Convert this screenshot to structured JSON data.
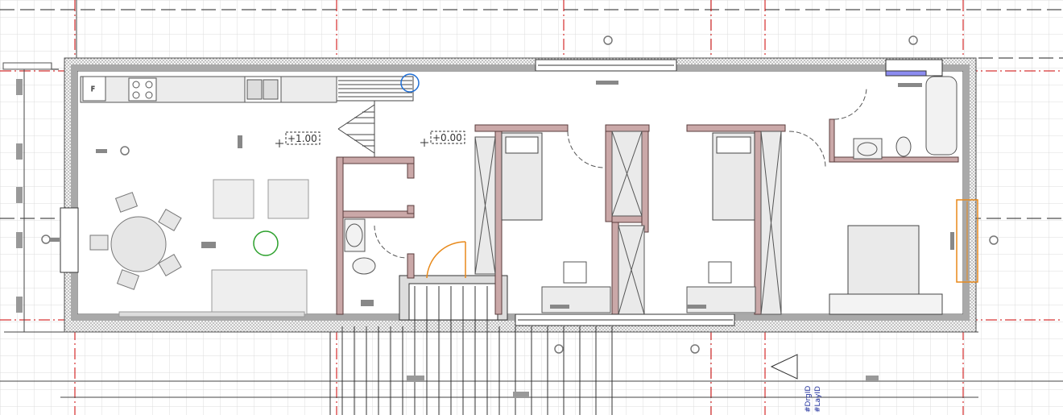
{
  "levels": [
    {
      "label": "+1.00"
    },
    {
      "label": "+0.00"
    }
  ],
  "kitchen": {
    "fridge_label": "F"
  },
  "id_tags": [
    {
      "label": "#DrgID"
    },
    {
      "label": "#LayID"
    }
  ],
  "colors": {
    "wall_fill": "#a9a9a9",
    "wall_hatch_bg": "#f2f2f2",
    "gridline": "#cc0000",
    "background_grid": "#dadada",
    "section_marker": "#e8891a",
    "selection_ring": "#1f6fd6",
    "origin_ring": "#2ca02c",
    "partition_wall": "#caa8a8",
    "blue_tag_text": "#1a2a9a"
  },
  "icons": [
    "section-marker-icon",
    "north-arrow-icon",
    "level-marker-icon",
    "elevation-tag-icon"
  ]
}
